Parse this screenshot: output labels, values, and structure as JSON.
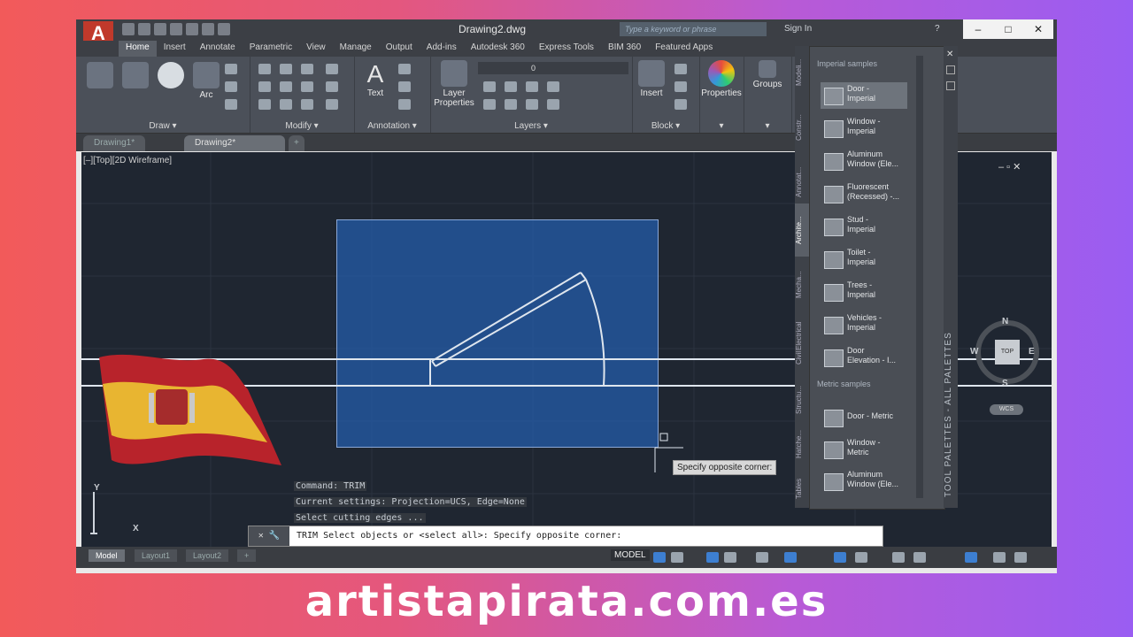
{
  "titlebar": {
    "app_letter": "A",
    "document_title": "Drawing2.dwg",
    "search_placeholder": "Type a keyword or phrase",
    "sign_in": "Sign In",
    "help": "?",
    "minimize": "–",
    "maximize": "□",
    "close": "✕"
  },
  "ribbon": {
    "tabs": [
      "Home",
      "Insert",
      "Annotate",
      "Parametric",
      "View",
      "Manage",
      "Output",
      "Add-ins",
      "Autodesk 360",
      "Express Tools",
      "BIM 360",
      "Featured Apps"
    ],
    "active_tab": "Home",
    "panels": {
      "draw": "Draw ▾",
      "modify": "Modify ▾",
      "annotation": "Annotation ▾",
      "layers": "Layers ▾",
      "block": "Block ▾",
      "properties_more": "▾",
      "groups_more": "▾"
    },
    "buttons": {
      "arc": "Arc",
      "text": "Text",
      "layer_properties_1": "Layer",
      "layer_properties_2": "Properties",
      "insert": "Insert",
      "properties": "Properties",
      "groups": "Groups",
      "layer_value": "0"
    }
  },
  "doc_tabs": [
    "Drawing1*",
    "Drawing2*",
    "+"
  ],
  "viewport": {
    "label": "[–][Top][2D Wireframe]",
    "tooltip": "Specify opposite corner:",
    "compass": {
      "n": "N",
      "s": "S",
      "e": "E",
      "w": "W",
      "top": "TOP",
      "wcs": "WCS"
    },
    "vp_controls": "–  ▫  ✕",
    "ucs": {
      "y": "Y",
      "x": "X"
    }
  },
  "command": {
    "history": [
      "Command: TRIM",
      "Current settings: Projection=UCS, Edge=None",
      "Select cutting edges ..."
    ],
    "prompt": "TRIM Select objects or <select all>: Specify opposite corner:",
    "tools": "✕ 🔧"
  },
  "status": {
    "layouts": [
      "Model",
      "Layout1",
      "Layout2",
      "+"
    ],
    "model_button": "MODEL"
  },
  "tool_palette": {
    "title": "TOOL PALETTES - ALL PALETTES",
    "vertical_tabs": [
      "Modeling",
      "Constraints",
      "Annotation",
      "Architectural",
      "Mechanical",
      "Electrical",
      "Civil",
      "Structural",
      "Hatches",
      "Tables"
    ],
    "active_vertical_tab": "Archite...",
    "imperial_header": "Imperial samples",
    "metric_header": "Metric samples",
    "imperial_items": [
      [
        "Door -",
        "Imperial"
      ],
      [
        "Window -",
        "Imperial"
      ],
      [
        "Aluminum",
        "Window (Ele..."
      ],
      [
        "Fluorescent",
        "(Recessed) -..."
      ],
      [
        "Stud -",
        "Imperial"
      ],
      [
        "Toilet -",
        "Imperial"
      ],
      [
        "Trees -",
        "Imperial"
      ],
      [
        "Vehicles -",
        "Imperial"
      ],
      [
        "Door",
        "Elevation - I..."
      ]
    ],
    "metric_items": [
      [
        "Door - Metric",
        ""
      ],
      [
        "Window -",
        "Metric"
      ],
      [
        "Aluminum",
        "Window (Ele..."
      ]
    ],
    "tab_labels_short": [
      "Modeli...",
      "Constr...",
      "Annotat...",
      "Archite...",
      "Mecha...",
      "Electrical",
      "Civil",
      "Structu...",
      "Hatche...",
      "Tables"
    ]
  },
  "watermark": "artistapirata.com.es",
  "colors": {
    "selection_fill": "#245caa",
    "canvas": "#1f2631",
    "ribbon": "#4b5059"
  }
}
